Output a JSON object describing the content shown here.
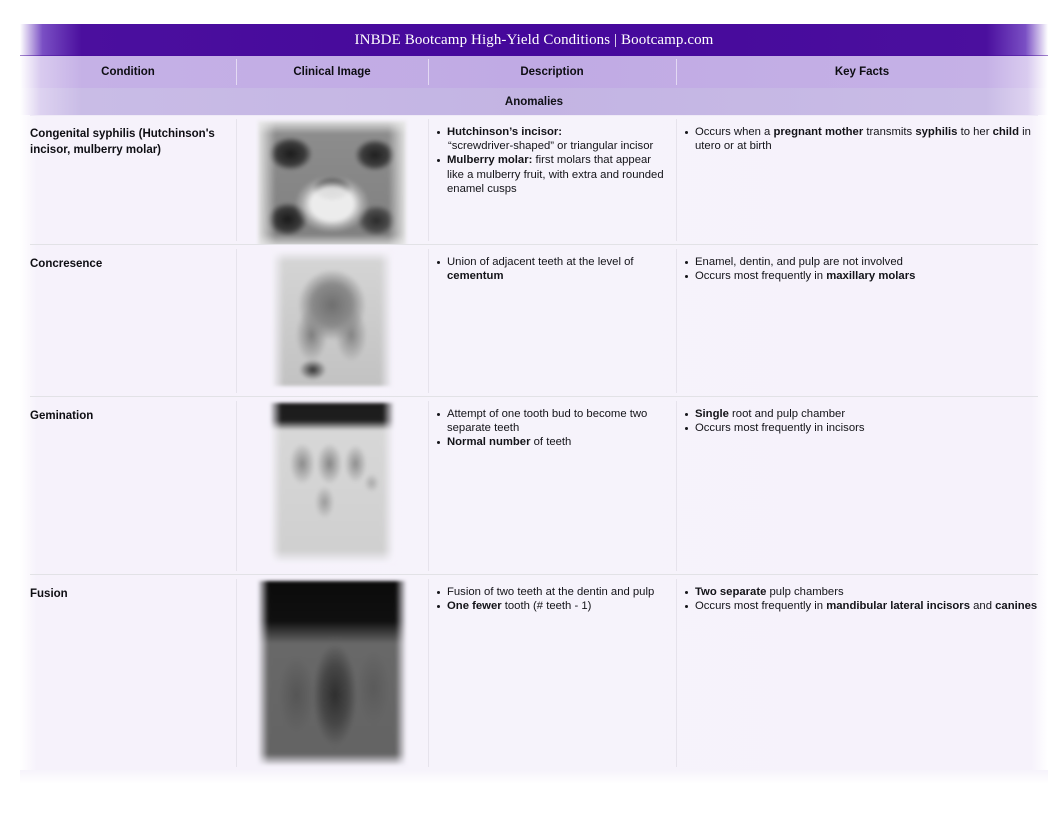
{
  "banner": {
    "title": "INBDE Bootcamp High-Yield Conditions | Bootcamp.com",
    "bg_color": "#45089b",
    "text_color": "#ffffff"
  },
  "table": {
    "columns": [
      "Condition",
      "Clinical Image",
      "Description",
      "Key Facts"
    ],
    "section_label": "Anomalies",
    "header_bg_color": "#c0aae4",
    "row_bg_color": "#f6f3fb",
    "rows": [
      {
        "condition": "Congenital syphilis (Hutchinson's incisor, mulberry molar)",
        "image_alt": "mulberry-molar-radiograph",
        "description": [
          {
            "bold": "Hutchinson's incisor:",
            "text": " “screwdriver-shaped” or triangular incisor"
          },
          {
            "bold": "Mulberry molar:",
            "text": " first molars that appear like a mulberry fruit, with extra and rounded enamel cusps"
          }
        ],
        "key_facts": [
          {
            "html": "Occurs when a <b>pregnant mother</b> transmits <b>syphilis</b> to her <b>child</b> in utero or at birth"
          }
        ]
      },
      {
        "condition": "Concresence",
        "image_alt": "concrescence-radiograph",
        "description": [
          {
            "html": "Union of adjacent teeth at the level of <b>cementum</b>"
          }
        ],
        "key_facts": [
          {
            "html": "Enamel, dentin, and pulp are not involved"
          },
          {
            "html": "Occurs most frequently in <b>maxillary molars</b>"
          }
        ]
      },
      {
        "condition": "Gemination",
        "image_alt": "gemination-radiograph",
        "description": [
          {
            "html": "Attempt of one tooth bud to become two separate teeth"
          },
          {
            "html": "<b>Normal number</b> of teeth"
          }
        ],
        "key_facts": [
          {
            "html": "<b>Single</b> root and pulp chamber"
          },
          {
            "html": "Occurs most frequently in incisors"
          }
        ]
      },
      {
        "condition": "Fusion",
        "image_alt": "fusion-radiograph",
        "description": [
          {
            "html": "Fusion of two teeth at the dentin and pulp"
          },
          {
            "html": "<b>One fewer</b> tooth (# teeth - 1)"
          }
        ],
        "key_facts": [
          {
            "html": "<b>Two separate</b> pulp chambers"
          },
          {
            "html": "Occurs most frequently in <b>mandibular lateral incisors</b> and <b>canines</b>"
          }
        ]
      }
    ]
  }
}
